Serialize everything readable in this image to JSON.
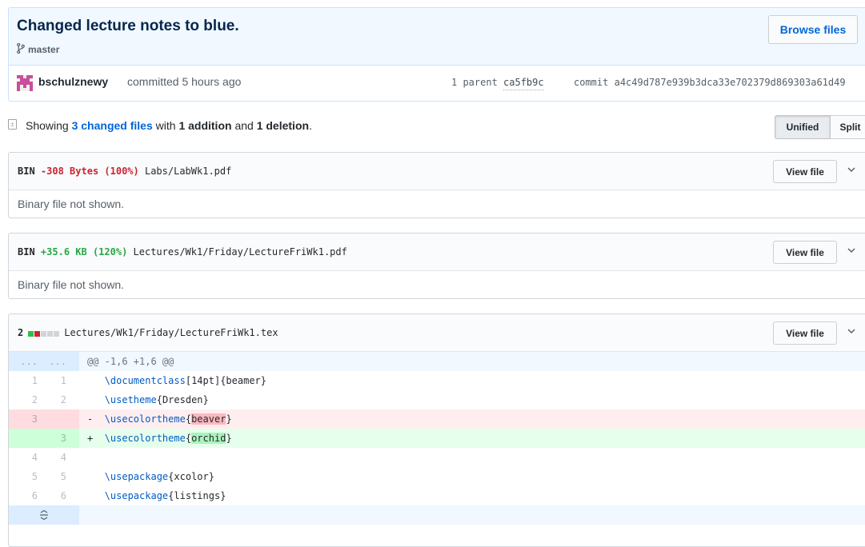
{
  "commit": {
    "title": "Changed lecture notes to blue.",
    "branch": "master",
    "browse_files": "Browse files",
    "author": "bschulznewy",
    "committed_text": "committed 5 hours ago",
    "parent_label": "1 parent",
    "parent_sha": "ca5fb9c",
    "commit_label": "commit",
    "commit_sha": "a4c49d787e939b3dca33e702379d869303a61d49"
  },
  "toc": {
    "showing": "Showing",
    "changed_files": "3 changed files",
    "with": "with",
    "additions": "1 addition",
    "and": "and",
    "deletions": "1 deletion",
    "period": ".",
    "unified": "Unified",
    "split": "Split"
  },
  "files": [
    {
      "type": "BIN",
      "size_change": "-308 Bytes (100%)",
      "path": "Labs/LabWk1.pdf",
      "view": "View file",
      "note": "Binary file not shown."
    },
    {
      "type": "BIN",
      "size_change": "+35.6 KB (120%)",
      "path": "Lectures/Wk1/Friday/LectureFriWk1.pdf",
      "view": "View file",
      "note": "Binary file not shown."
    },
    {
      "changes": "2",
      "path": "Lectures/Wk1/Friday/LectureFriWk1.tex",
      "view": "View file",
      "diffstat": [
        "add",
        "del",
        "neutral",
        "neutral",
        "neutral"
      ],
      "diffstat_colors": {
        "add": "#2cbe4e",
        "del": "#cb2431",
        "neutral": "#d1d5da"
      },
      "hunk_header": "@@ -1,6 +1,6 @@",
      "hunk_dots": "...",
      "lines": [
        {
          "kind": "ctx",
          "old": "1",
          "new": "1",
          "sign": " ",
          "cmd": "\\documentclass",
          "rest": "[14pt]{beamer}"
        },
        {
          "kind": "ctx",
          "old": "2",
          "new": "2",
          "sign": " ",
          "cmd": "\\usetheme",
          "rest": "{Dresden}"
        },
        {
          "kind": "del",
          "old": "3",
          "new": "",
          "sign": "-",
          "cmd": "\\usecolortheme",
          "pre": "{",
          "word": "beaver",
          "post": "}"
        },
        {
          "kind": "add",
          "old": "",
          "new": "3",
          "sign": "+",
          "cmd": "\\usecolortheme",
          "pre": "{",
          "word": "orchid",
          "post": "}"
        },
        {
          "kind": "ctx",
          "old": "4",
          "new": "4",
          "sign": " ",
          "cmd": "",
          "rest": ""
        },
        {
          "kind": "ctx",
          "old": "5",
          "new": "5",
          "sign": " ",
          "cmd": "\\usepackage",
          "rest": "{xcolor}"
        },
        {
          "kind": "ctx",
          "old": "6",
          "new": "6",
          "sign": " ",
          "cmd": "\\usepackage",
          "rest": "{listings}"
        }
      ],
      "expand_icon": "expand-icon"
    }
  ],
  "colors": {
    "link": "#0366d6",
    "deletion_red": "#cb2431",
    "addition_green": "#28a745",
    "avatar_pink": "#c94e9b"
  }
}
